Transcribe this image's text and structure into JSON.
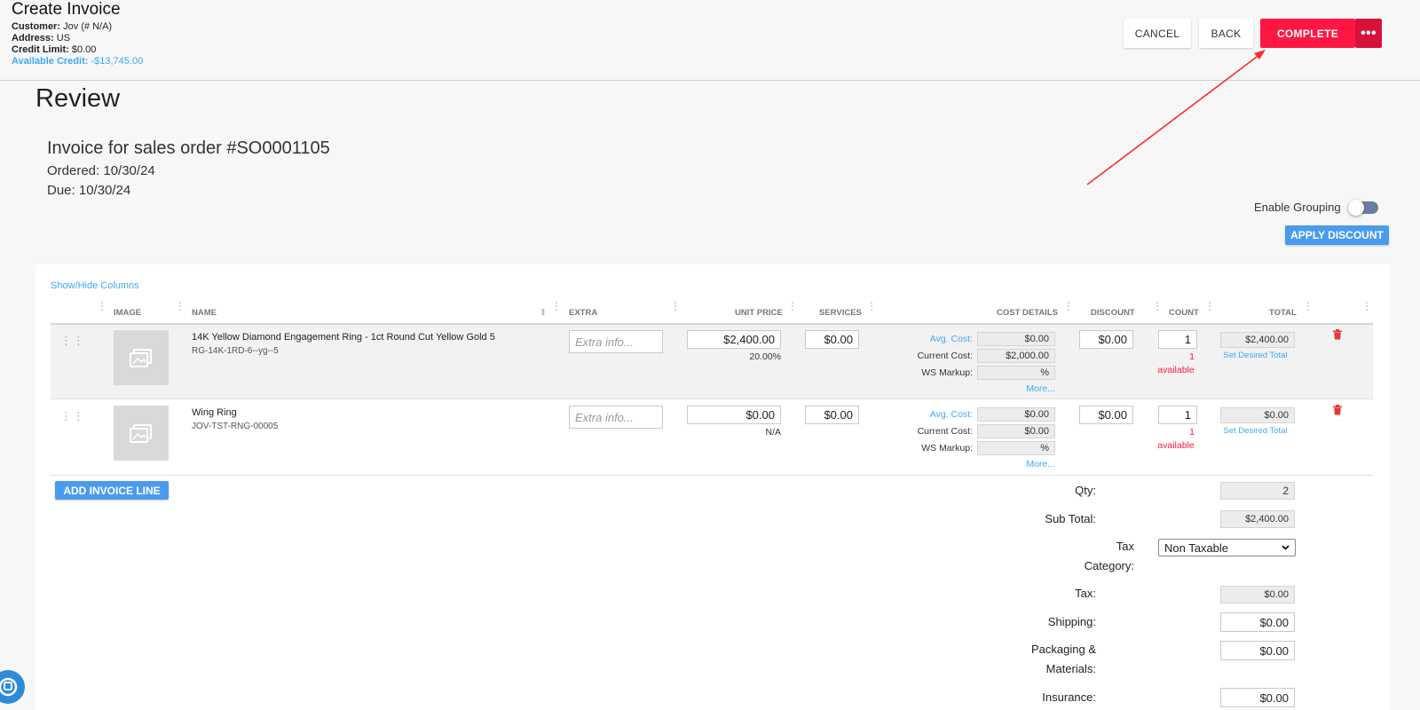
{
  "header": {
    "title": "Create Invoice",
    "customer_label": "Customer:",
    "customer_value": "Jov (# N/A)",
    "address_label": "Address:",
    "address_value": "US",
    "credit_limit_label": "Credit Limit:",
    "credit_limit_value": "$0.00",
    "available_credit_label": "Available Credit:",
    "available_credit_value": "-$13,745.00",
    "buttons": {
      "cancel": "CANCEL",
      "back": "BACK",
      "complete": "COMPLETE",
      "more": "•••"
    }
  },
  "review": {
    "title": "Review",
    "order_title": "Invoice for sales order #SO0001105",
    "ordered": "Ordered: 10/30/24",
    "due": "Due: 10/30/24",
    "enable_grouping_label": "Enable Grouping",
    "apply_discount": "APPLY DISCOUNT",
    "show_hide_columns": "Show/Hide Columns",
    "add_invoice_line": "ADD INVOICE LINE"
  },
  "columns": {
    "image": "IMAGE",
    "name": "NAME",
    "extra": "EXTRA",
    "unit_price": "UNIT PRICE",
    "services": "SERVICES",
    "cost_details": "COST DETAILS",
    "discount": "DISCOUNT",
    "count": "COUNT",
    "total": "TOTAL"
  },
  "labels": {
    "extra_placeholder": "Extra info...",
    "avg_cost": "Avg. Cost:",
    "current_cost": "Current Cost:",
    "ws_markup": "WS Markup:",
    "more": "More...",
    "set_desired_total": "Set Desired Total",
    "available": "available"
  },
  "lines": [
    {
      "name": "14K Yellow Diamond Engagement Ring - 1ct Round Cut Yellow Gold 5",
      "sku": "RG-14K-1RD-6--yg--5",
      "unit_price": "$2,400.00",
      "margin": "20.00%",
      "services": "$0.00",
      "avg_cost": "$0.00",
      "current_cost": "$2,000.00",
      "ws_markup": "%",
      "discount": "$0.00",
      "count": "1",
      "available_count": "1",
      "total": "$2,400.00"
    },
    {
      "name": "Wing Ring",
      "sku": "JOV-TST-RNG-00005",
      "unit_price": "$0.00",
      "margin": "N/A",
      "services": "$0.00",
      "avg_cost": "$0.00",
      "current_cost": "$0.00",
      "ws_markup": "%",
      "discount": "$0.00",
      "count": "1",
      "available_count": "1",
      "total": "$0.00"
    }
  ],
  "summary": {
    "qty_label": "Qty:",
    "qty_value": "2",
    "subtotal_label": "Sub Total:",
    "subtotal_value": "$2,400.00",
    "tax_category_label_1": "Tax",
    "tax_category_label_2": "Category:",
    "tax_category_value": "Non Taxable",
    "tax_label": "Tax:",
    "tax_value": "$0.00",
    "shipping_label": "Shipping:",
    "shipping_value": "$0.00",
    "packaging_label_1": "Packaging &",
    "packaging_label_2": "Materials:",
    "packaging_value": "$0.00",
    "insurance_label": "Insurance:",
    "insurance_value": "$0.00"
  },
  "colors": {
    "accent_red": "#ff1744",
    "accent_blue": "#4a9bef",
    "link_blue": "#3fa7f5"
  }
}
